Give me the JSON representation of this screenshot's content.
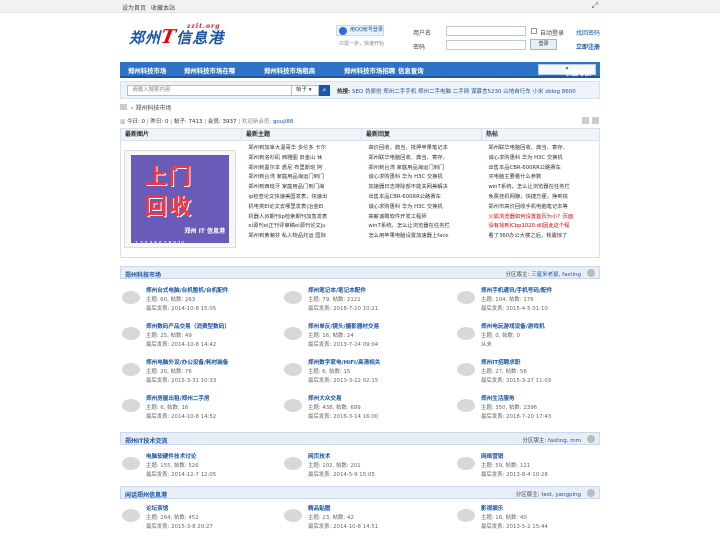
{
  "topbar": {
    "set_home": "设为首页",
    "bookmark": "收藏本站"
  },
  "logo": {
    "left": "郑州",
    "mid": "T",
    "right": "信息港",
    "url": "zzit.org"
  },
  "qq_login": {
    "label": "用QQ帐号登录",
    "sub": "只需一步，快速开始"
  },
  "login": {
    "user_label": "用户名",
    "pass_label": "密码",
    "remember": "自动登录",
    "find_pwd": "找回密码",
    "submit": "登录",
    "register": "立即注册"
  },
  "nav": {
    "items": [
      "郑州科技市场",
      "郑州科技市场在哪",
      "郑州科技市场租商",
      "郑州科技市场招聘",
      "信息查询"
    ],
    "quick": "快捷导航"
  },
  "search": {
    "placeholder": "请输入搜索内容",
    "type": "帖子",
    "hot_label": "热搜:",
    "hot": "SEO  伪原创  郑州二手手机  郑州二手电脑  二手网  谋慕言5230  山地自行车  小米  zblog  8600"
  },
  "breadcrumb": {
    "label": "郑州科技市场"
  },
  "stats": {
    "today": "今日: 0",
    "yesterday": "昨日: 0",
    "topics": "帖子: 7413",
    "members": "会员: 3937",
    "newest": "欢迎新会员: ",
    "new_member": "gouji88"
  },
  "blocks": {
    "headers": [
      "最新图片",
      "最新主题",
      "最新回复",
      "热帖"
    ],
    "new_topics": [
      "郑州到加拿大温哥华 多伦多 卡尔",
      "郑州到洛杉矶 西雅图 旧金山 休",
      "郑州到墨尔本 悉尼 布里斯班 阿",
      "郑州到台湾 家庭用品海运门到门",
      "郑州到西班牙 家庭用品门到门海",
      "ip检查论文快速美国发表，快速出",
      "机电类EI论文去哪里发表|冶金EI",
      "机器人|6期刊ip检索期刊加急发表",
      "ei源刊ei正刊评审稿ei源刊论文ju",
      "郑州到黄菊芬 私人物品托运 国际"
    ],
    "new_replies": [
      "高价回收，典当，抵押苹果笔记本",
      "郑州联华电脑回收、典当、寄存、",
      "郑州到台湾 家庭用品海运门到门",
      "诚心求购惠科 华为 H3C 交换机",
      "加速器日志排除部不能关网美解决",
      "出售本品CBR-600RR公路赛车",
      "诚心求购惠科 华为 H3C 交换机",
      "高薪诚聘软件开发工程师",
      "win7系统，怎么让浏览器在任务栏",
      "怎么用苹果电脑设置加速器上face"
    ],
    "hot": [
      "郑州联华电脑回收、典当、寄存、",
      "诚心求购惠科 华为 H3C 交换机",
      "出售本品CBR-600RR公路赛车",
      "买电脑主要看什么参数",
      "win7系统，怎么让浏览器在任务栏",
      "免费挂机网赚，快捷方便，挣到钱",
      "郑州市高价回收手机电脑笔记本等",
      "火狐浏览器如何设置首页为小？页面",
      "没有找到ICbp1020.dll因此这个程",
      "看了360办公大楼之后，我震惊了"
    ],
    "hot_red": [
      7,
      8
    ]
  },
  "image_block": {
    "line1": "上门",
    "line2": "回收",
    "caption": "郑州 IT 信息港",
    "pager": "1 2 3 4 5 6 7 8 9 10"
  },
  "cat1": {
    "name": "郑州科技市场",
    "mod_label": "分区版主: ",
    "mods": "三星米老鼠, fasting",
    "forums": [
      {
        "title": "郑州台式电脑/台机整机/台机配件",
        "stats": "主题: 60, 帖数: 263",
        "last": "最后发表: 2014-10-8 15:05"
      },
      {
        "title": "郑州笔记本/笔记本配件",
        "stats": "主题: 79, 帖数: 2121",
        "last": "最后发表: 2018-7-20 10:21"
      },
      {
        "title": "郑州手机通讯/手机号码/配件",
        "stats": "主题: 104, 帖数: 176",
        "last": "最后发表: 2015-4-5 01:10"
      },
      {
        "title": "郑州数码产品交易（消费型数码）",
        "stats": "主题: 25, 帖数: 49",
        "last": "最后发表: 2014-10-8 14:42"
      },
      {
        "title": "郑州单反/镜头/摄影器材交易",
        "stats": "主题: 16, 帖数: 24",
        "last": "最后发表: 2013-7-24 09:04"
      },
      {
        "title": "郑州电玩游戏设备/游戏机",
        "stats": "主题: 0, 帖数: 0",
        "last": "从未"
      },
      {
        "title": "郑州电脑外设/办公设备/耗材装备",
        "stats": "主题: 20, 帖数: 76",
        "last": "最后发表: 2015-3-31 10:33"
      },
      {
        "title": "郑州数字家电/HiFi/高清相关",
        "stats": "主题: 6, 帖数: 15",
        "last": "最后发表: 2013-3-22 02:15"
      },
      {
        "title": "郑州IT招聘求职",
        "stats": "主题: 27, 帖数: 56",
        "last": "最后发表: 2015-3-27 11:03"
      },
      {
        "title": "郑州房屋出租/郑州二手房",
        "stats": "主题: 6, 帖数: 16",
        "last": "最后发表: 2014-10-8 14:52"
      },
      {
        "title": "郑州大众交易",
        "stats": "主题: 438, 帖数: 699",
        "last": "最后发表: 2016-3-14 16:00"
      },
      {
        "title": "郑州生活服务",
        "stats": "主题: 350, 帖数: 2396",
        "last": "最后发表: 2018-7-20 17:43"
      }
    ]
  },
  "cat2": {
    "name": "郑州IT技术交流",
    "mod_label": "分区版主: ",
    "mods": "fasting, mm",
    "forums": [
      {
        "title": "电脑软硬件技术讨论",
        "stats": "主题: 155, 帖数: 526",
        "last": "最后发表: 2014-12-7 12:05"
      },
      {
        "title": "网页技术",
        "stats": "主题: 102, 帖数: 201",
        "last": "最后发表: 2014-5-9 15:05"
      },
      {
        "title": "网络营销",
        "stats": "主题: 59, 帖数: 121",
        "last": "最后发表: 2013-8-4 10:28"
      }
    ]
  },
  "cat3": {
    "name": "闲话郑州信息港",
    "mod_label": "分区版主: ",
    "mods": "test, yangping",
    "forums": [
      {
        "title": "论坛茶馆",
        "stats": "主题: 264, 帖数: 452",
        "last": "最后发表: 2015-3-8 20:27"
      },
      {
        "title": "精品贴图",
        "stats": "主题: 23, 帖数: 42",
        "last": "最后发表: 2014-10-8 14:51"
      },
      {
        "title": "影视娱乐",
        "stats": "主题: 16, 帖数: 40",
        "last": "最后发表: 2013-5-2 15:44"
      }
    ]
  },
  "colors": {
    "brand": "#2f73c7",
    "link": "#1a56a4",
    "red": "#d00"
  }
}
